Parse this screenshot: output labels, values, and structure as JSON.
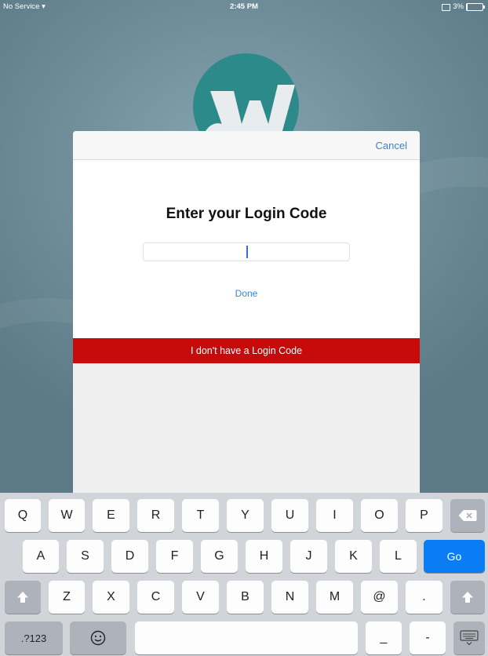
{
  "status_bar": {
    "carrier": "No Service",
    "time": "2:45 PM",
    "battery": "3%",
    "battery_level": 0.03
  },
  "modal": {
    "cancel_label": "Cancel",
    "title": "Enter your Login Code",
    "input_value": "",
    "done_label": "Done",
    "no_code_label": "I don't have a Login Code"
  },
  "keyboard": {
    "row1": [
      "Q",
      "W",
      "E",
      "R",
      "T",
      "Y",
      "U",
      "I",
      "O",
      "P"
    ],
    "row2": [
      "A",
      "S",
      "D",
      "F",
      "G",
      "H",
      "J",
      "K",
      "L"
    ],
    "row3": [
      "Z",
      "X",
      "C",
      "V",
      "B",
      "N",
      "M",
      "@",
      "."
    ],
    "go_label": "Go",
    "numbers_label": ".?123",
    "underscore_label": "_",
    "dash_label": "-",
    "emoji_icon": "smiley-icon",
    "shift_icon": "shift-arrow-icon",
    "backspace_icon": "backspace-icon",
    "dismiss_icon": "keyboard-dismiss-icon"
  },
  "colors": {
    "accent": "#3a84d3",
    "danger": "#c70a0a",
    "go": "#0a7df5"
  }
}
